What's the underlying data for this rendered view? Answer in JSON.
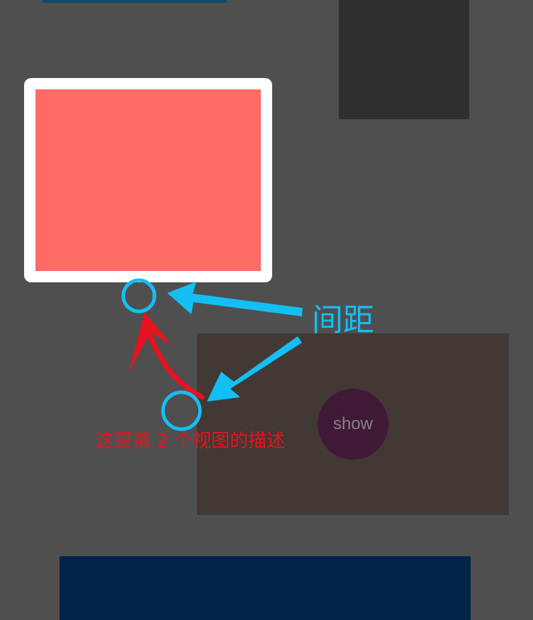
{
  "show_button": {
    "label": "show"
  },
  "annotations": {
    "spacing_label": "间距",
    "description": "这是第 2 个视图的描述"
  },
  "colors": {
    "background": "#4f4f4f",
    "red_view": "#ff6b66",
    "brown_view": "#423834",
    "bottom_panel": "#02244a",
    "annotation_blue": "#13bff5",
    "annotation_red": "#e8121e"
  }
}
